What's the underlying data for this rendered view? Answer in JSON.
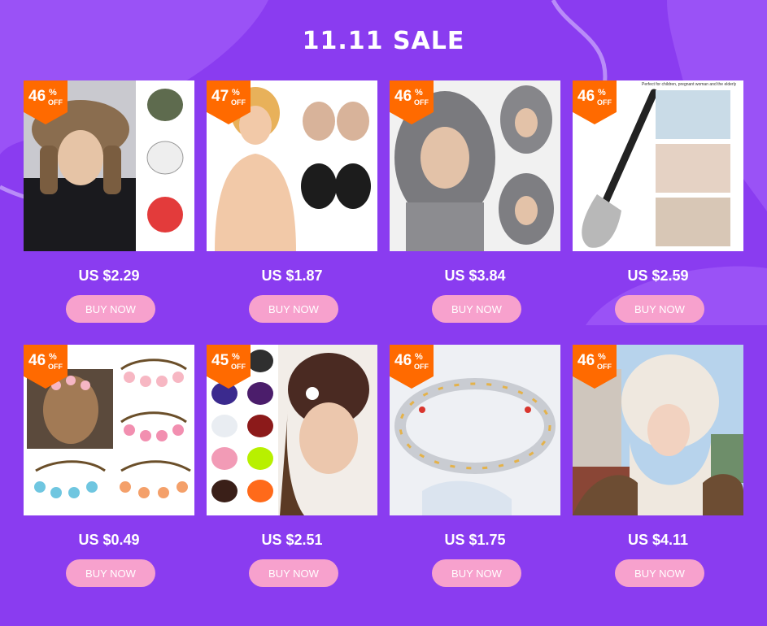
{
  "banner": {
    "title": "11.11 SALE"
  },
  "theme": {
    "background": "#8a3cf0",
    "badge": "#ff6a00",
    "button": "#f7a1cd"
  },
  "products": [
    {
      "discount": "46",
      "percent_sign": "%",
      "off_label": "OFF",
      "price": "US $2.29",
      "button_label": "BUY NOW",
      "image": "trapper-hat-photo"
    },
    {
      "discount": "47",
      "percent_sign": "%",
      "off_label": "OFF",
      "price": "US $1.87",
      "button_label": "BUY NOW",
      "image": "adhesive-bra-photo"
    },
    {
      "discount": "46",
      "percent_sign": "%",
      "off_label": "OFF",
      "price": "US $3.84",
      "button_label": "BUY NOW",
      "image": "fur-hood-photo"
    },
    {
      "discount": "46",
      "percent_sign": "%",
      "off_label": "OFF",
      "price": "US $2.59",
      "button_label": "BUY NOW",
      "image": "shoe-horn-photo",
      "caption": "Perfect for children, pregnant woman and the elderly"
    },
    {
      "discount": "46",
      "percent_sign": "%",
      "off_label": "OFF",
      "price": "US $0.49",
      "button_label": "BUY NOW",
      "image": "flower-headband-photo"
    },
    {
      "discount": "45",
      "percent_sign": "%",
      "off_label": "OFF",
      "price": "US $2.51",
      "button_label": "BUY NOW",
      "image": "led-beanie-photo"
    },
    {
      "discount": "46",
      "percent_sign": "%",
      "off_label": "OFF",
      "price": "US $1.75",
      "button_label": "BUY NOW",
      "image": "bracelet-photo"
    },
    {
      "discount": "46",
      "percent_sign": "%",
      "off_label": "OFF",
      "price": "US $4.11",
      "button_label": "BUY NOW",
      "image": "knit-hat-photo"
    }
  ]
}
